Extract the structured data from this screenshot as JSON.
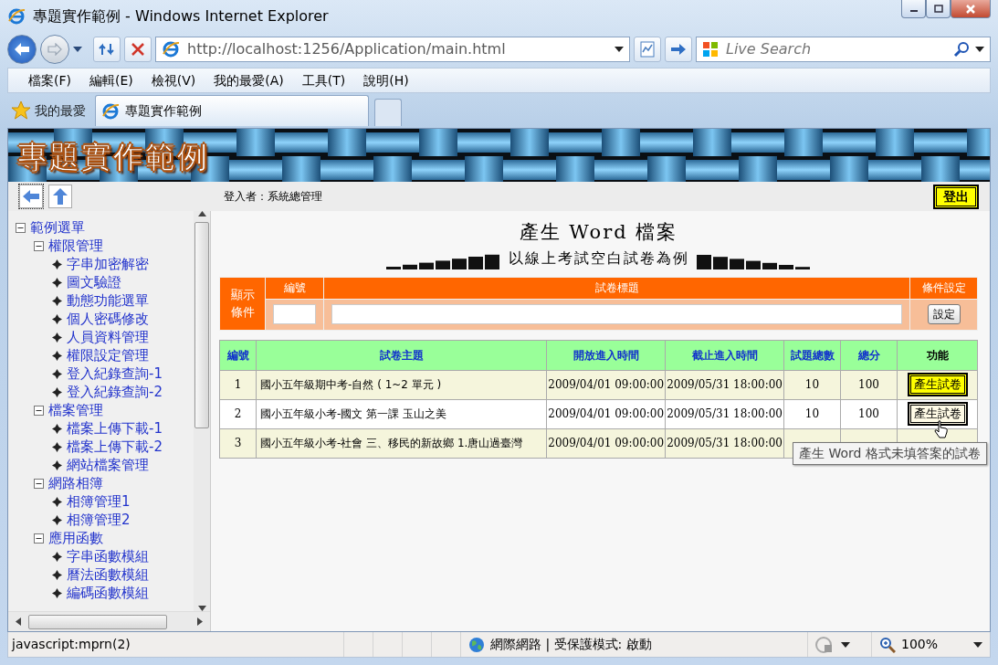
{
  "window": {
    "title": "專題實作範例 - Windows Internet Explorer"
  },
  "navigation": {
    "address": "http://localhost:1256/Application/main.html",
    "search_placeholder": "Live Search"
  },
  "menu": [
    "檔案(F)",
    "編輯(E)",
    "檢視(V)",
    "我的最愛(A)",
    "工具(T)",
    "說明(H)"
  ],
  "favorites": {
    "label": "我的最愛"
  },
  "tabs": [
    {
      "label": "專題實作範例",
      "selected": true
    }
  ],
  "page": {
    "banner_title": "專題實作範例",
    "login_label": "登入者：系統總管理",
    "logout": "登出",
    "sidebar": {
      "tree": [
        {
          "label": "範例選單",
          "expanded": true,
          "children": [
            {
              "label": "權限管理",
              "expanded": true,
              "children": [
                {
                  "label": "字串加密解密"
                },
                {
                  "label": "圖文驗證"
                },
                {
                  "label": "動態功能選單"
                },
                {
                  "label": "個人密碼修改"
                },
                {
                  "label": "人員資料管理"
                },
                {
                  "label": "權限設定管理"
                },
                {
                  "label": "登入紀錄查詢-1"
                },
                {
                  "label": "登入紀錄查詢-2"
                }
              ]
            },
            {
              "label": "檔案管理",
              "expanded": true,
              "children": [
                {
                  "label": "檔案上傳下載-1"
                },
                {
                  "label": "檔案上傳下載-2"
                },
                {
                  "label": "網站檔案管理"
                }
              ]
            },
            {
              "label": "網路相簿",
              "expanded": true,
              "children": [
                {
                  "label": "相簿管理1"
                },
                {
                  "label": "相簿管理2"
                }
              ]
            },
            {
              "label": "應用函數",
              "expanded": true,
              "children": [
                {
                  "label": "字串函數模組"
                },
                {
                  "label": "曆法函數模組"
                },
                {
                  "label": "編碼函數模組"
                }
              ]
            }
          ]
        }
      ]
    },
    "heading": "產生 Word 檔案",
    "subheading": "以線上考試空白試卷為例",
    "filter": {
      "side_label": "顯示條件",
      "columns": [
        "編號",
        "試卷標題",
        "條件設定"
      ],
      "button": "設定"
    },
    "table": {
      "columns": [
        "編號",
        "試卷主題",
        "開放進入時間",
        "截止進入時間",
        "試題總數",
        "總分",
        "功能"
      ],
      "rows": [
        {
          "no": "1",
          "title": "國小五年級期中考-自然 ( 1~2 單元 )",
          "open": "2009/04/01 09:00:00",
          "close": "2009/05/31 18:00:00",
          "count": "10",
          "score": "100",
          "action": "產生試卷",
          "hovered": false
        },
        {
          "no": "2",
          "title": "國小五年級小考-國文 第一課 玉山之美",
          "open": "2009/04/01 09:00:00",
          "close": "2009/05/31 18:00:00",
          "count": "10",
          "score": "100",
          "action": "產生試卷",
          "hovered": true
        },
        {
          "no": "3",
          "title": "國小五年級小考-社會 三、移民的新故鄉 1.唐山過臺灣",
          "open": "2009/04/01 09:00:00",
          "close": "2009/05/31 18:00:00"
        }
      ]
    },
    "tooltip": "產生 Word 格式未填答案的試卷"
  },
  "status_bar": {
    "text": "javascript:mprn(2)",
    "zone": "網際網路 | 受保護模式: 啟動",
    "zoom": "100%"
  }
}
